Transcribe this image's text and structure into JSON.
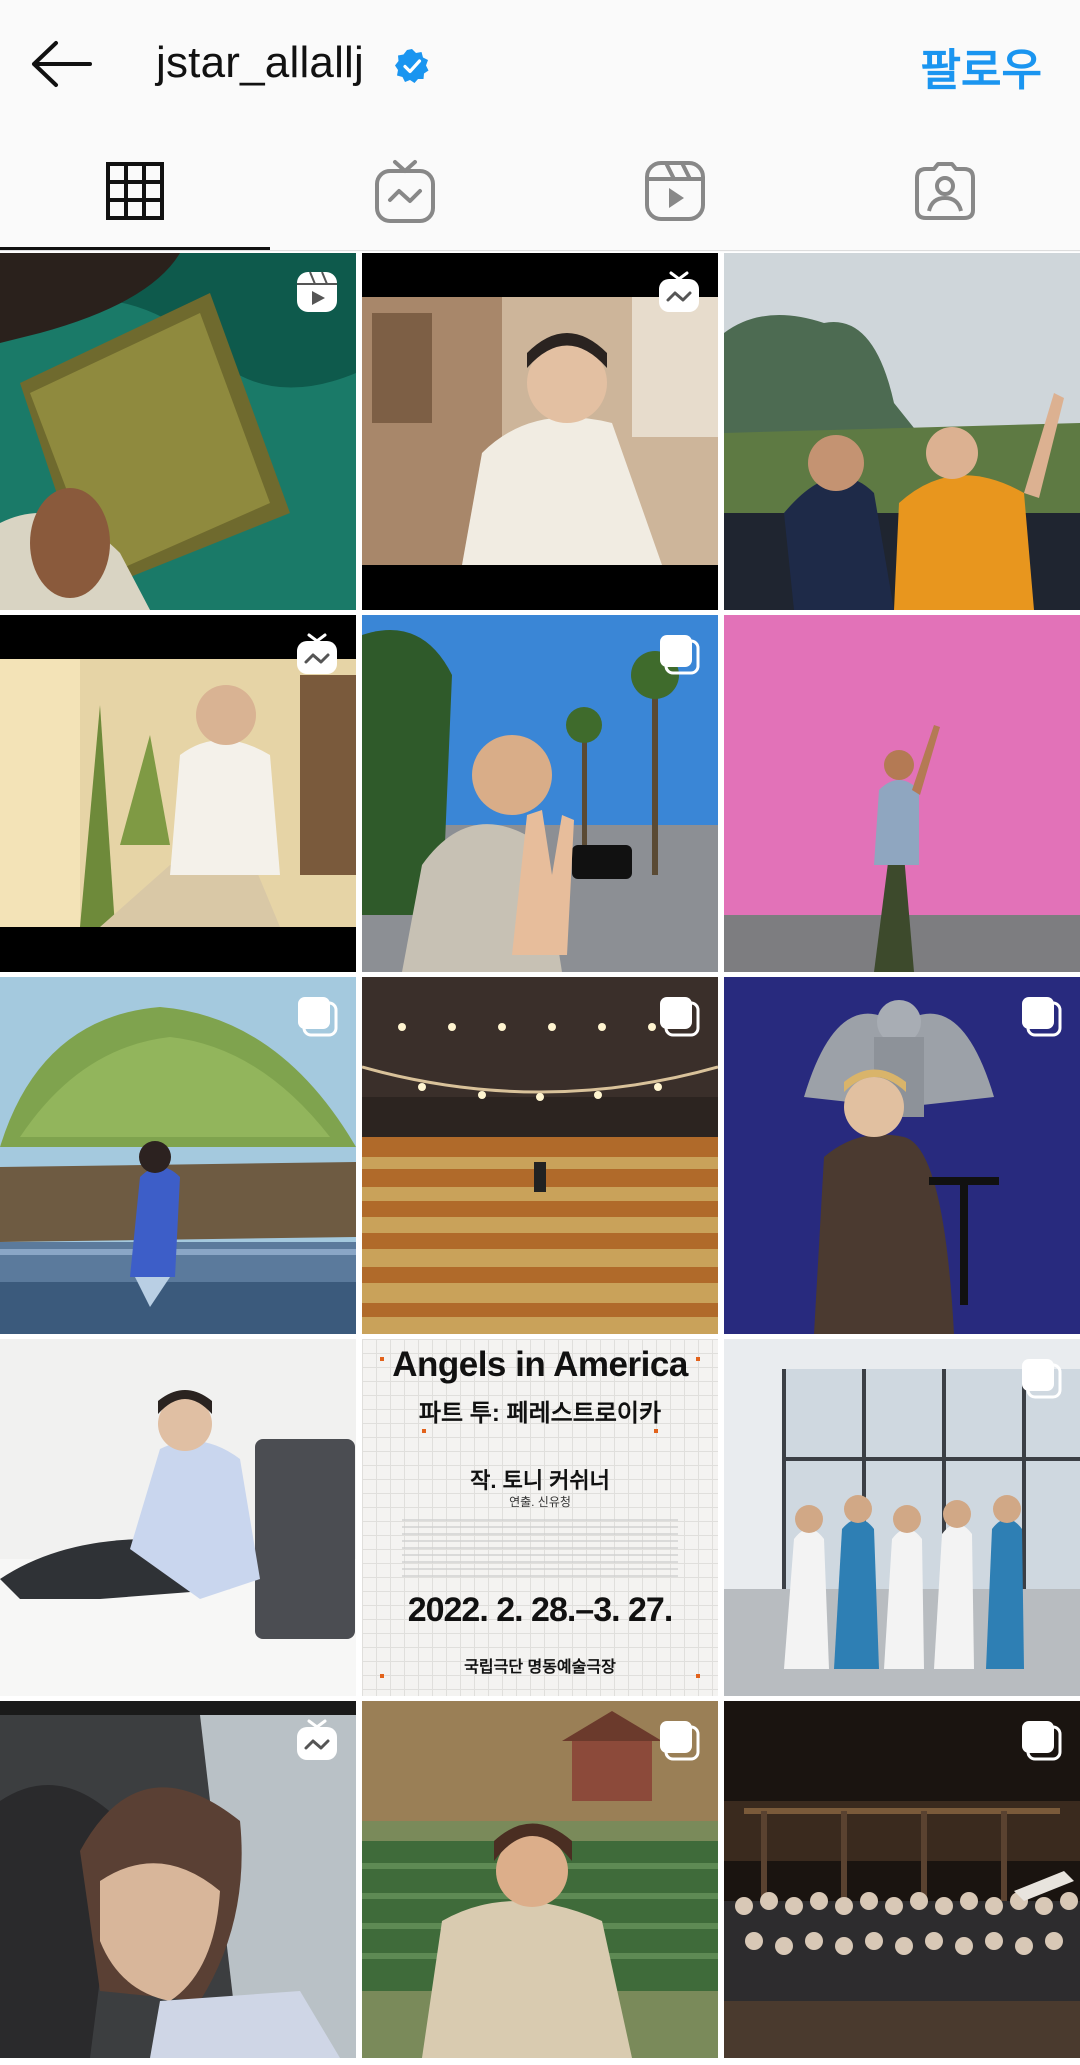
{
  "header": {
    "username": "jstar_allallj",
    "follow_label": "팔로우"
  },
  "tabs": [
    {
      "name": "grid",
      "icon": "grid-icon",
      "active": true
    },
    {
      "name": "igtv",
      "icon": "igtv-icon",
      "active": false
    },
    {
      "name": "reels",
      "icon": "reels-icon",
      "active": false
    },
    {
      "name": "tagged",
      "icon": "tagged-user-icon",
      "active": false
    }
  ],
  "colors": {
    "accent": "#1a95f0",
    "verified": "#1a95f0",
    "poster_accent": "#e2621b"
  },
  "posts": [
    {
      "subject": "person reading a book",
      "badge": "reels-icon"
    },
    {
      "subject": "man sitting in kitchen",
      "badge": "igtv-icon"
    },
    {
      "subject": "two men posing by a mountain",
      "badge": "none"
    },
    {
      "subject": "man with phone by plants",
      "badge": "igtv-icon"
    },
    {
      "subject": "man waving on street",
      "badge": "carousel-icon"
    },
    {
      "subject": "person walking by pink wall",
      "badge": "none"
    },
    {
      "subject": "man posing under large tree",
      "badge": "carousel-icon"
    },
    {
      "subject": "theater auditorium seats",
      "badge": "carousel-icon"
    },
    {
      "subject": "man in coat on stage",
      "badge": "carousel-icon"
    },
    {
      "subject": "man sitting on floor",
      "badge": "none"
    },
    {
      "subject": "play poster",
      "badge": "none"
    },
    {
      "subject": "group in medical uniforms",
      "badge": "carousel-icon"
    },
    {
      "subject": "man sleeping",
      "badge": "igtv-icon"
    },
    {
      "subject": "man in fleece jacket",
      "badge": "carousel-icon"
    },
    {
      "subject": "group photo on stage",
      "badge": "carousel-icon"
    }
  ],
  "poster": {
    "title": "Angels in America",
    "subtitle": "파트 투: 페레스트로이카",
    "author": "작. 토니 커쉬너",
    "director": "연출. 신유청",
    "date": "2022. 2. 28.–3. 27.",
    "venue": "국립극단 명동예술극장"
  }
}
